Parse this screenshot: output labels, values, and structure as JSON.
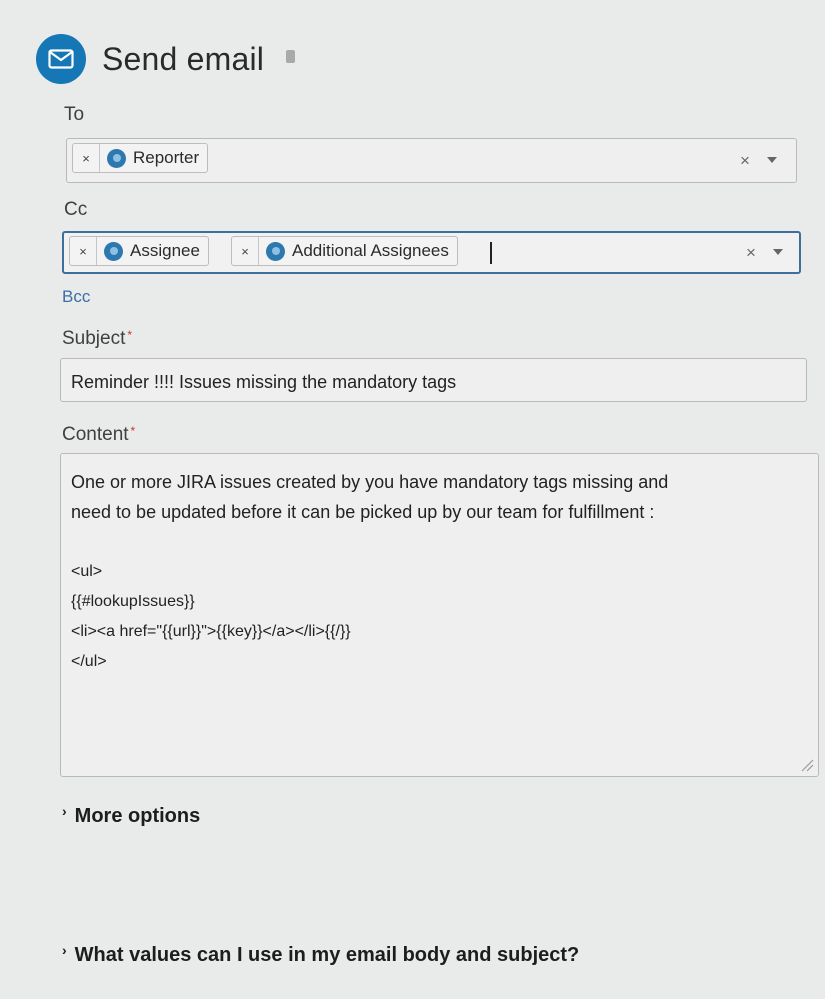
{
  "header": {
    "title": "Send email",
    "icon": "mail-icon"
  },
  "to": {
    "label": "To",
    "recipients": [
      "Reporter"
    ]
  },
  "cc": {
    "label": "Cc",
    "recipients": [
      "Assignee",
      "Additional Assignees"
    ]
  },
  "bcc": {
    "label": "Bcc"
  },
  "subject": {
    "label": "Subject",
    "value": "Reminder !!!! Issues missing the mandatory tags"
  },
  "content": {
    "label": "Content",
    "lines": [
      "One or more JIRA issues created by you have mandatory tags missing and",
      "need to be updated before it can be picked up by our team for fulfillment :",
      "",
      "<ul>",
      "{{#lookupIssues}}",
      "<li><a href=\"{{url}}\">{{key}}</a></li>{{/}}",
      "</ul>"
    ]
  },
  "more_options": {
    "label": "More options"
  },
  "help": {
    "label": "What values can I use in my email body and subject?"
  },
  "colors": {
    "accent": "#1577b6",
    "required": "#c0392b",
    "link": "#3b6fa7",
    "focus_border": "#3d6e9e"
  }
}
